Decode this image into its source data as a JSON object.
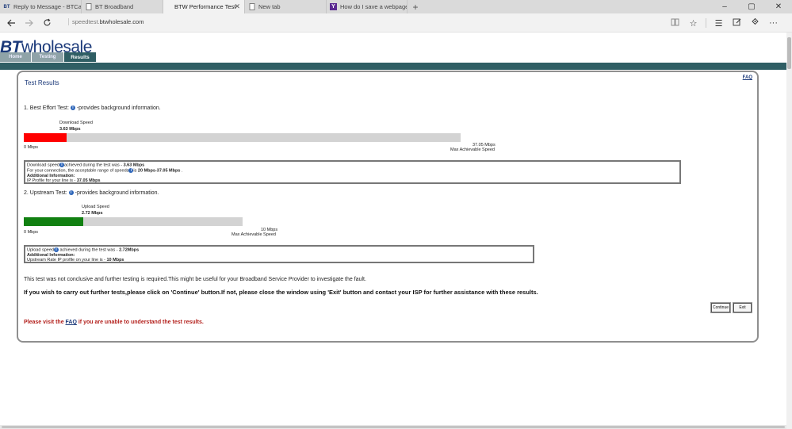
{
  "browser": {
    "tabs": [
      {
        "favicon": "BT",
        "label": "Reply to Message - BTCare C",
        "active": false
      },
      {
        "favicon": "page-icon",
        "label": "BT Broadband",
        "active": false
      },
      {
        "favicon": "",
        "label": "BTW Performance Test",
        "active": true
      },
      {
        "favicon": "page-icon",
        "label": "New tab",
        "active": false
      },
      {
        "favicon": "Y",
        "label": "How do I save a webpage as",
        "active": false
      }
    ],
    "close_glyph": "✕",
    "new_tab_glyph": "+",
    "url_domain": "speedtest.",
    "url_host": "btwholesale.com",
    "window_controls": [
      "–",
      "▢",
      "✕"
    ]
  },
  "site": {
    "logo_bt": "BT",
    "logo_rest": "wholesale",
    "nav": [
      "Home",
      "Testing",
      "Results"
    ]
  },
  "results": {
    "title": "Test Results",
    "faq_link": "FAQ",
    "best_effort_heading": "1. Best Effort Test:",
    "info_suffix": "-provides background information.",
    "download_label": "Download Speed",
    "download_value": "3.63 Mbps",
    "download_fraction": 0.098,
    "zero_label": "0 Mbps",
    "download_max": "37.05 Mbps",
    "max_label": "Max Achievable Speed",
    "download_info": {
      "line1_a": "Download speed",
      "line1_b": "achieved during the test was - ",
      "line1_value": "3.63 Mbps",
      "line2_a": "For your connection, the acceptable range of speeds",
      "line2_b": "is ",
      "line2_value": "20 Mbps-37.05 Mbps",
      "line2_end": " .",
      "line3": "Additional Information:",
      "line4_a": "IP Profile for your line is - ",
      "line4_value": "37.05 Mbps"
    },
    "upstream_heading": "2. Upstream Test:",
    "upload_label": "Upload Speed",
    "upload_value": "2.72 Mbps",
    "upload_fraction": 0.272,
    "upload_max": "10 Mbps",
    "upload_info": {
      "line1_a": "Upload speed",
      "line1_b": " achieved during the test was - ",
      "line1_value": "2.72Mbps",
      "line2": "Additional Information:",
      "line3_a": "Upstream Rate IP profile on your line is - ",
      "line3_value": "10 Mbps"
    },
    "inconclusive": "This test was not conclusive and further testing is required.This might be useful for your Broadband Service Provider to investigate the fault.",
    "further": "If you wish to carry out further tests,please click on 'Continue' button.If not, please close the window using 'Exit' button and contact your ISP for further assistance with these results.",
    "continue_button": "Continue",
    "exit_button": "Exit",
    "visit_a": "Please visit the ",
    "visit_link": "FAQ",
    "visit_b": " if you are unable to understand the test results."
  },
  "colors": {
    "download_bar": "#ff0000",
    "upload_bar": "#118011",
    "brand": "#1c3a7a",
    "band": "#2f5e64"
  }
}
